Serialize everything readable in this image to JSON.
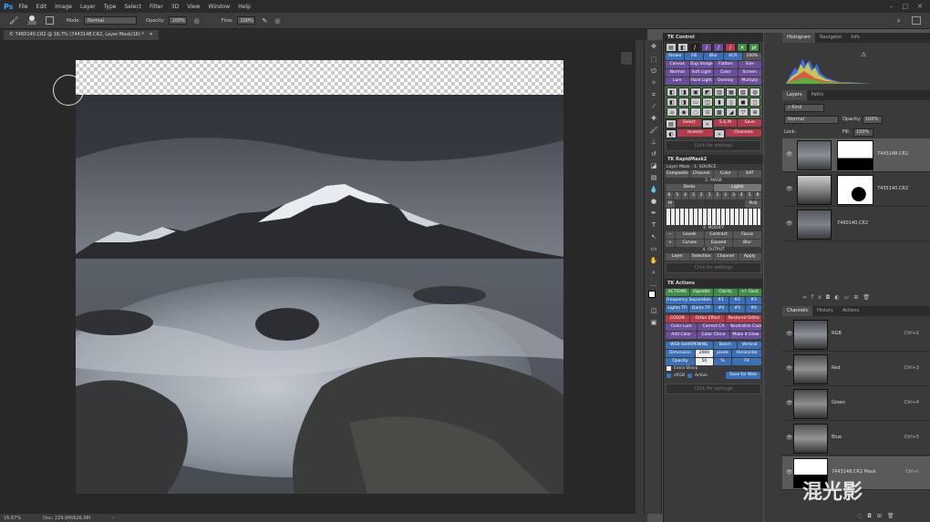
{
  "app": {
    "logo": "Ps",
    "menu": [
      "File",
      "Edit",
      "Image",
      "Layer",
      "Type",
      "Select",
      "Filter",
      "3D",
      "View",
      "Window",
      "Help"
    ]
  },
  "options": {
    "mode_label": "Mode:",
    "mode_value": "Normal",
    "opacity_label": "Opacity:",
    "opacity_value": "100%",
    "flow_label": "Flow:",
    "flow_value": "100%",
    "brush_size": "300"
  },
  "document": {
    "tab_title": "© 7460140.CR2 @ 16,7% (7443148.CR2, Layer Mask/16) *",
    "zoom": "16,67%",
    "doc_info": "Doc: 229,9M/626,9M"
  },
  "tk_control": {
    "title": "TK Control",
    "r1": [
      "Stroke",
      "Fill",
      "Blur",
      "ACR",
      "100%"
    ],
    "r2": [
      "Canvas",
      "Dup Image",
      "Flatten",
      "Size"
    ],
    "r3": [
      "Normal",
      "Soft Light",
      "Color",
      "Screen"
    ],
    "r4": [
      "Lum",
      "Hard Light",
      "Overlay",
      "Multiply"
    ],
    "r5": [
      "Select",
      "S & M",
      "Save"
    ],
    "r6": [
      "Inverse",
      "Channels"
    ],
    "settings": "Click for settings"
  },
  "tk_rapidmask": {
    "title": "TK RapidMask2",
    "layer_mask": "Layer Mask - 1. SOURCE",
    "source": [
      "Composite",
      "Channel",
      "Color",
      "SAT"
    ],
    "mask_label": "2. MASK",
    "mask_tabs": [
      "Darks",
      "Lights"
    ],
    "numbers": [
      "6",
      "5",
      "4",
      "3",
      "2",
      "1",
      "1",
      "2",
      "3",
      "4",
      "5",
      "6"
    ],
    "mid": [
      "M"
    ],
    "pick": "Pick",
    "modify_label": "3. MODIFY",
    "modify1": [
      "Levels",
      "Contract",
      "Focus"
    ],
    "modify2": [
      "Curves",
      "Expand",
      "Blur"
    ],
    "output_label": "4. OUTPUT",
    "output": [
      "Layer",
      "Selection",
      "Channel",
      "Apply"
    ],
    "settings": "Click for settings"
  },
  "tk_actions": {
    "title": "TK Actions",
    "actions_label": "ACTIONS",
    "a1": [
      "Vignette",
      "Clarity",
      "+/- Dust"
    ],
    "a2": [
      "Frequency Separation",
      "#1",
      "#2",
      "#3"
    ],
    "a3": [
      "Lights TP",
      "Darks TP",
      "#4",
      "#5",
      "#6"
    ],
    "color_label": "COLOR",
    "c1": [
      "Orton Effect",
      "Restored Ortho"
    ],
    "c2": [
      "Color Lum",
      "Correct CA",
      "Neutralize Cast"
    ],
    "c3": [
      "Add Color",
      "Color Clone",
      "Make it Glow"
    ],
    "web_label": "WEB SHARPENING",
    "w1": [
      "Batch",
      "Vertical"
    ],
    "dimension_label": "Dimension",
    "dimension_value": "2000",
    "pixels": "pixels",
    "horizontal": "Horizontal",
    "opacity_label": "Opacity",
    "opacity_value": "50",
    "pct": "%",
    "fit": "Fit",
    "extra_sharp": "Extra Sharp",
    "srgb": "sRGB",
    "action": "Action",
    "save_web": "Save for Web",
    "settings": "Click for settings"
  },
  "right_panel": {
    "top_tabs": [
      "Histogram",
      "Navigator",
      "Info"
    ],
    "layer_tabs": [
      "Layers",
      "Paths"
    ],
    "kind": "Kind",
    "blend": "Normal",
    "opacity_label": "Opacity:",
    "opacity_value": "100%",
    "lock_label": "Lock:",
    "fill_label": "Fill:",
    "fill_value": "100%",
    "layers": [
      "7443148.CR2",
      "7435140.CR2",
      "7460140.CR2"
    ],
    "channel_tabs": [
      "Channels",
      "History",
      "Actions"
    ],
    "channels": [
      {
        "name": "RGB",
        "shortcut": "Ctrl+2"
      },
      {
        "name": "Red",
        "shortcut": "Ctrl+3"
      },
      {
        "name": "Green",
        "shortcut": "Ctrl+4"
      },
      {
        "name": "Blue",
        "shortcut": "Ctrl+5"
      },
      {
        "name": "7443148.CR2 Mask",
        "shortcut": "Ctrl+\\"
      }
    ],
    "watermark": "混光影"
  }
}
